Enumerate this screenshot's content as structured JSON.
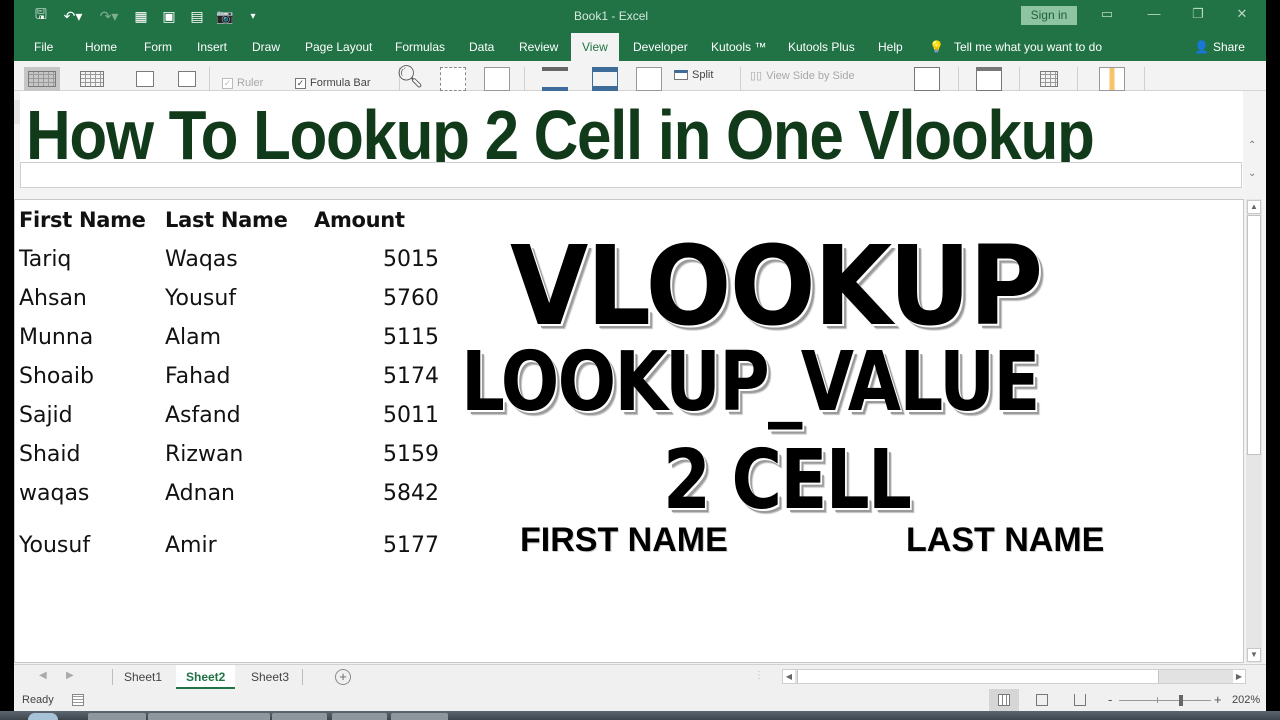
{
  "window": {
    "title": "Book1  -  Excel",
    "sign_in": "Sign in",
    "controls": {
      "ribbon_display": "▭",
      "minimize": "—",
      "restore": "❐",
      "close": "✕"
    }
  },
  "quick_access": [
    {
      "name": "save-icon",
      "glyph": "🖫"
    },
    {
      "name": "undo-icon",
      "glyph": "↶▾"
    },
    {
      "name": "redo-icon",
      "glyph": "↷▾"
    },
    {
      "name": "form-icon",
      "glyph": "▦"
    },
    {
      "name": "freeze-icon",
      "glyph": "▣"
    },
    {
      "name": "sheet-icon",
      "glyph": "▤"
    },
    {
      "name": "camera-icon",
      "glyph": "📷"
    },
    {
      "name": "customize-icon",
      "glyph": "▾"
    }
  ],
  "ribbon_tabs": [
    "File",
    "Home",
    "Form",
    "Insert",
    "Draw",
    "Page Layout",
    "Formulas",
    "Data",
    "Review",
    "View",
    "Developer",
    "Kutools ™",
    "Kutools Plus",
    "Help"
  ],
  "active_tab": "View",
  "tell_me": "Tell me what you want to do",
  "share": "Share",
  "ribbon_view": {
    "ruler_label": "Ruler",
    "ruler_checked": true,
    "ruler_enabled": false,
    "formula_bar_label": "Formula Bar",
    "formula_bar_checked": true,
    "split_label": "Split",
    "side_by_side_label": "View Side by Side",
    "check_mark": "✓"
  },
  "banner": {
    "title": "How To Lookup 2 Cell in One Vlookup",
    "color": "#103a19"
  },
  "table": {
    "headers": [
      "First Name",
      "Last Name",
      "Amount"
    ],
    "rows": [
      [
        "Tariq",
        "Waqas",
        "5015"
      ],
      [
        "Ahsan",
        "Yousuf",
        "5760"
      ],
      [
        "Munna",
        "Alam",
        "5115"
      ],
      [
        "Shoaib",
        "Fahad",
        "5174"
      ],
      [
        "Sajid",
        "Asfand",
        "5011"
      ],
      [
        "Shaid",
        "Rizwan",
        "5159"
      ],
      [
        "waqas",
        "Adnan",
        "5842"
      ],
      [
        "Yousuf",
        "Amir",
        "5177"
      ]
    ]
  },
  "overlay": {
    "line1": "VLOOKUP",
    "line2": "LOOKUP_VALUE",
    "line3": "2 CELL",
    "first_name": "FIRST NAME",
    "last_name": "LAST NAME"
  },
  "sheets": [
    "Sheet1",
    "Sheet2",
    "Sheet3"
  ],
  "active_sheet": "Sheet2",
  "add_sheet": "+",
  "status": {
    "ready": "Ready",
    "zoom": "202%",
    "zoom_minus": "-",
    "zoom_plus": "+"
  },
  "accent_color": "#217346"
}
